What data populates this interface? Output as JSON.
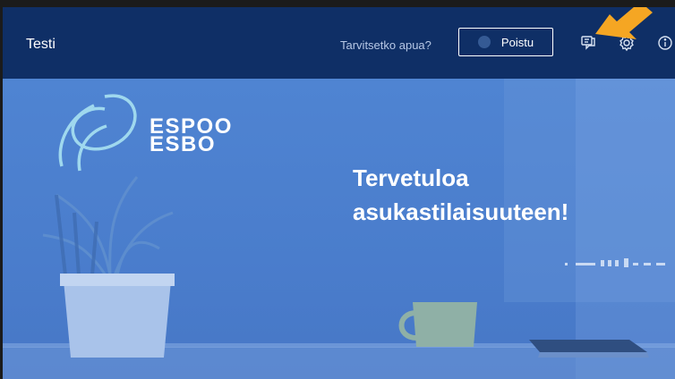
{
  "window": {
    "title": "Testi"
  },
  "header": {
    "help_text": "Tarvitsetko apua?",
    "leave_label": "Poistu",
    "icons": [
      "chat-icon",
      "gear-icon",
      "info-icon"
    ]
  },
  "slide": {
    "logo_line1": "ESPOO",
    "logo_line2": "ESBO",
    "headline_line1": "Tervetuloa",
    "headline_line2": "asukastilaisuuteen!"
  },
  "colors": {
    "titlebar": "#0f2f66",
    "slide_background": "#4c7fcc",
    "pointer_arrow": "#f5a623"
  }
}
